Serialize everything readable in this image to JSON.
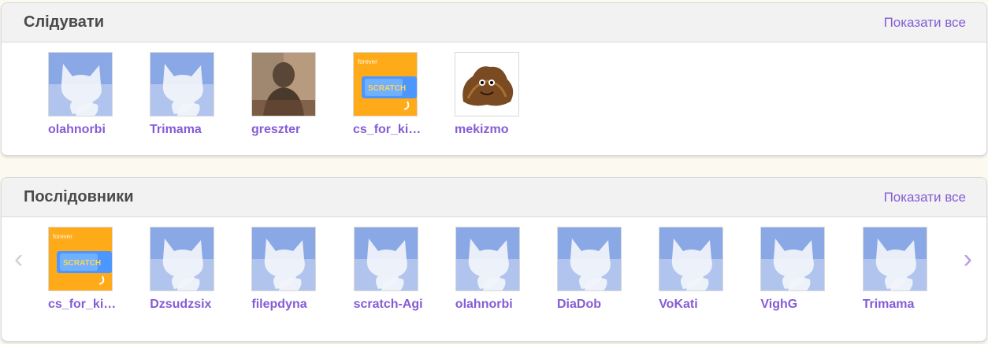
{
  "colors": {
    "accent": "#855cd6",
    "page_background": "#fbf9f0",
    "header_background": "#f2f2f2",
    "title": "#4a4a4a",
    "cat_gradient_top": "#8aa8e6",
    "cat_gradient_bottom": "#c9d7f4"
  },
  "following": {
    "title": "Слідувати",
    "show_all_label": "Показати все",
    "users": [
      {
        "username": "olahnorbi",
        "avatar": "default-cat-icon"
      },
      {
        "username": "Trimama",
        "avatar": "default-cat-icon"
      },
      {
        "username": "greszter",
        "avatar": "photo-portrait"
      },
      {
        "username": "cs_for_ki…",
        "avatar": "scratch-forever-block-icon"
      },
      {
        "username": "mekizmo",
        "avatar": "furry-creature-icon"
      }
    ]
  },
  "followers": {
    "title": "Послідовники",
    "show_all_label": "Показати все",
    "prev_icon": "chevron-left-icon",
    "next_icon": "chevron-right-icon",
    "users": [
      {
        "username": "cs_for_ki…",
        "avatar": "scratch-forever-block-icon"
      },
      {
        "username": "Dzsudzsix",
        "avatar": "default-cat-icon"
      },
      {
        "username": "filepdyna",
        "avatar": "default-cat-icon"
      },
      {
        "username": "scratch-Agi",
        "avatar": "default-cat-icon"
      },
      {
        "username": "olahnorbi",
        "avatar": "default-cat-icon"
      },
      {
        "username": "DiaDob",
        "avatar": "default-cat-icon"
      },
      {
        "username": "VoKati",
        "avatar": "default-cat-icon"
      },
      {
        "username": "VighG",
        "avatar": "default-cat-icon"
      },
      {
        "username": "Trimama",
        "avatar": "default-cat-icon"
      }
    ]
  }
}
